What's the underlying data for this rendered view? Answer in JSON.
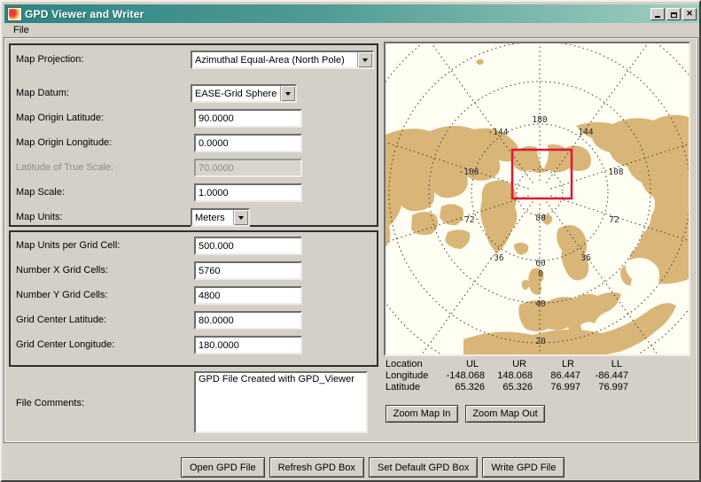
{
  "window": {
    "title": "GPD Viewer and Writer",
    "controls": {
      "close_glyph": "✕"
    }
  },
  "menu": {
    "items": [
      {
        "label": "File"
      }
    ]
  },
  "form": {
    "projection": {
      "label": "Map Projection:",
      "value": "Azimuthal Equal-Area (North Pole)"
    },
    "datum": {
      "label": "Map Datum:",
      "value": "EASE-Grid Sphere"
    },
    "origin_lat": {
      "label": "Map Origin Latitude:",
      "value": "90.0000"
    },
    "origin_lon": {
      "label": "Map Origin Longitude:",
      "value": "0.0000"
    },
    "true_scale_lat": {
      "label": "Latitude of True Scale:",
      "value": "70.0000",
      "disabled": true
    },
    "map_scale": {
      "label": "Map Scale:",
      "value": "1.0000"
    },
    "map_units": {
      "label": "Map Units:",
      "value": "Meters"
    },
    "units_per_cell": {
      "label": "Map Units per Grid Cell:",
      "value": "500.000"
    },
    "x_cells": {
      "label": "Number X Grid Cells:",
      "value": "5760"
    },
    "y_cells": {
      "label": "Number Y Grid Cells:",
      "value": "4800"
    },
    "center_lat": {
      "label": "Grid Center Latitude:",
      "value": "80.0000"
    },
    "center_lon": {
      "label": "Grid Center Longitude:",
      "value": "180.0000"
    },
    "comments": {
      "label": "File Comments:",
      "value": "GPD File Created with GPD_Viewer"
    }
  },
  "map": {
    "graticule_labels": [
      {
        "text": "180"
      },
      {
        "text": "-144"
      },
      {
        "text": "144"
      },
      {
        "text": "-108"
      },
      {
        "text": "108"
      },
      {
        "text": "-72"
      },
      {
        "text": "72"
      },
      {
        "text": "-36"
      },
      {
        "text": "36"
      },
      {
        "text": "0"
      },
      {
        "text": "80"
      },
      {
        "text": "60"
      },
      {
        "text": "40"
      },
      {
        "text": "20"
      }
    ],
    "colors": {
      "land": "#D9B678",
      "ocean": "#FFFEF3",
      "graticule": "#3a3a3a",
      "grid_box": "#DE1738"
    }
  },
  "location": {
    "headers": [
      "Location",
      "UL",
      "UR",
      "LR",
      "LL"
    ],
    "rows": [
      {
        "name": "Longitude",
        "values": [
          "-148.068",
          "148.068",
          "86.447",
          "-86.447"
        ]
      },
      {
        "name": "Latitude",
        "values": [
          "65.326",
          "65.326",
          "76.997",
          "76.997"
        ]
      }
    ]
  },
  "map_controls": {
    "zoom_in": "Zoom Map In",
    "zoom_out": "Zoom Map Out"
  },
  "actions": {
    "open": "Open GPD File",
    "refresh": "Refresh GPD Box",
    "set_default": "Set Default GPD Box",
    "write": "Write GPD File"
  }
}
